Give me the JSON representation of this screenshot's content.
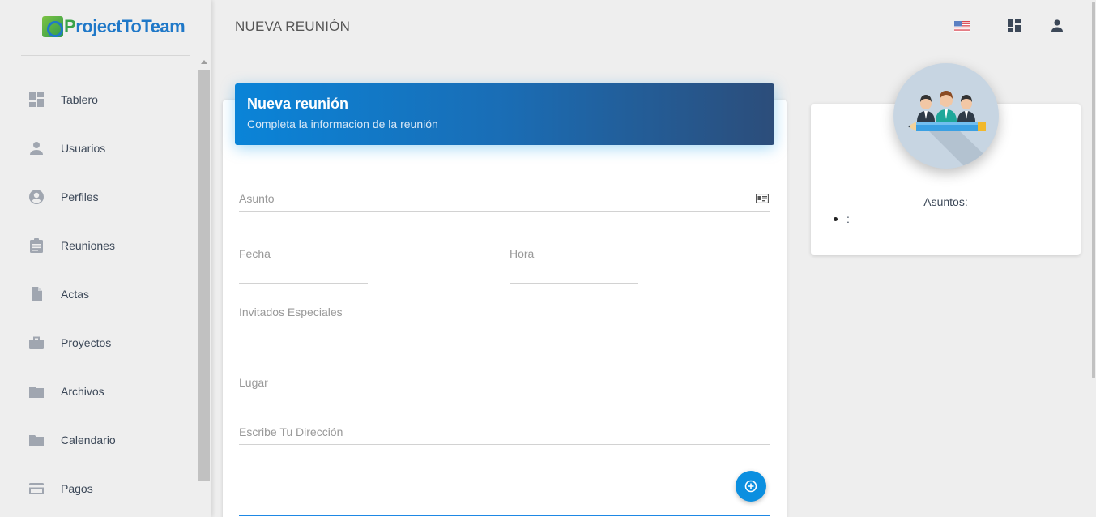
{
  "app": {
    "logo_text_a": "P",
    "logo_text_b": "rojectToTeam"
  },
  "header": {
    "title": "NUEVA REUNIÓN"
  },
  "sidebar": {
    "items": [
      {
        "label": "Tablero",
        "icon": "dashboard-icon"
      },
      {
        "label": "Usuarios",
        "icon": "person-icon"
      },
      {
        "label": "Perfiles",
        "icon": "account-circle-icon"
      },
      {
        "label": "Reuniones",
        "icon": "assignment-icon"
      },
      {
        "label": "Actas",
        "icon": "document-icon"
      },
      {
        "label": "Proyectos",
        "icon": "briefcase-icon"
      },
      {
        "label": "Archivos",
        "icon": "folder-icon"
      },
      {
        "label": "Calendario",
        "icon": "folder-icon"
      },
      {
        "label": "Pagos",
        "icon": "credit-card-icon"
      }
    ]
  },
  "form": {
    "title": "Nueva reunión",
    "subtitle": "Completa la informacion de la reunión",
    "asunto_label": "Asunto",
    "fecha_label": "Fecha",
    "hora_label": "Hora",
    "invitados_label": "Invitados Especiales",
    "lugar_label": "Lugar",
    "direccion_placeholder": "Escribe Tu Dirección"
  },
  "side": {
    "asuntos_label": "Asuntos:",
    "asuntos_items": [
      ":"
    ]
  },
  "colors": {
    "accent": "#0b8fe0",
    "header_gradient_start": "#0a84d8",
    "header_gradient_end": "#2c4d7a",
    "icon_gray": "#a0a6b0"
  }
}
